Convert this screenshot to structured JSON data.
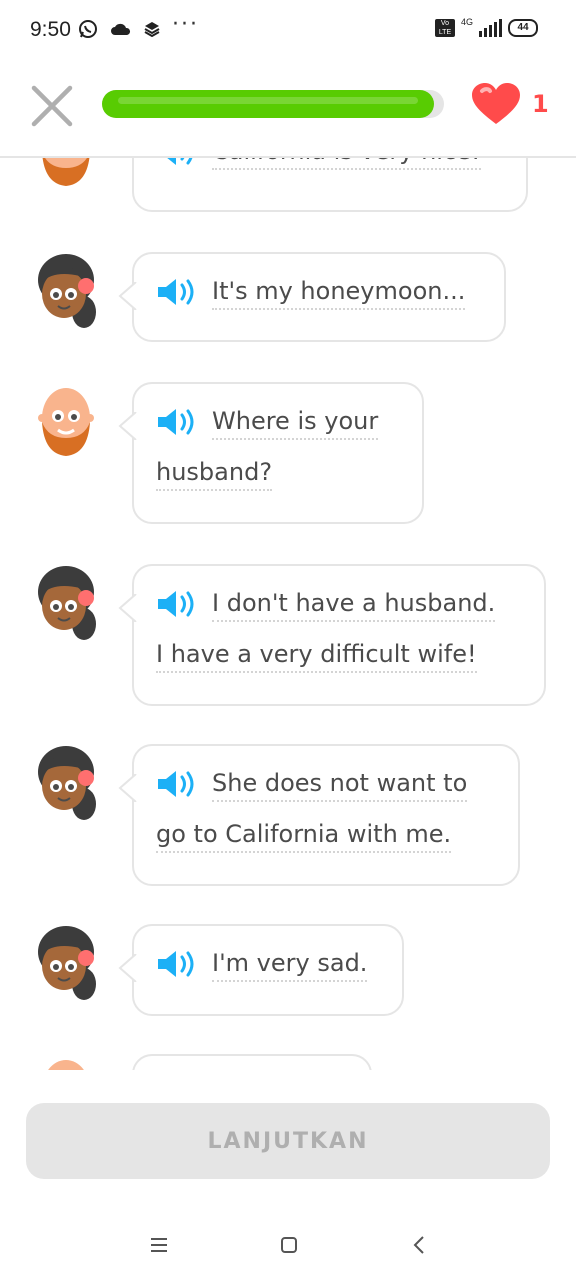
{
  "status_bar": {
    "time": "9:50",
    "more": "···",
    "volte": "Vo LTE",
    "network": "4G",
    "battery": "44"
  },
  "header": {
    "progress_fraction": 0.97,
    "hearts": "1",
    "progress_color": "#58cc02",
    "heart_color": "#ff4b4b"
  },
  "messages": [
    {
      "speaker": "man",
      "lines": [
        "California is very nice!"
      ]
    },
    {
      "speaker": "woman",
      "lines": [
        "It's my honeymoon..."
      ]
    },
    {
      "speaker": "man",
      "lines": [
        "Where is your",
        "husband?"
      ]
    },
    {
      "speaker": "woman",
      "lines": [
        "I don't have a husband.",
        "I have a very difficult wife!"
      ]
    },
    {
      "speaker": "woman",
      "lines": [
        "She does not want to",
        "go to California with me."
      ]
    },
    {
      "speaker": "woman",
      "lines": [
        "I'm very sad."
      ]
    }
  ],
  "continue_button": "LANJUTKAN",
  "speaker_color": "#1cb0f6"
}
